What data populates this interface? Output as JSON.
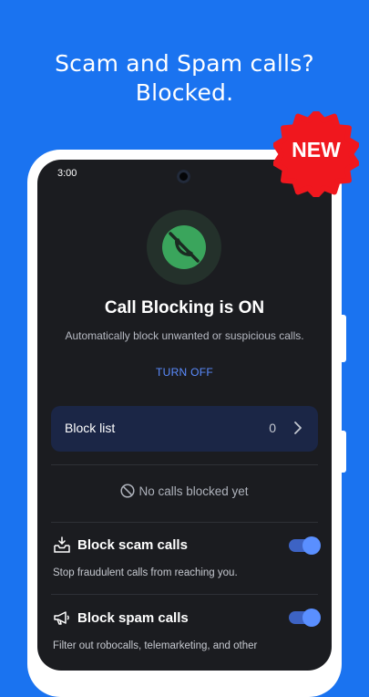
{
  "headline": {
    "line1": "Scam and Spam calls?",
    "line2": "Blocked."
  },
  "badge": {
    "label": "NEW",
    "color": "#f0171e"
  },
  "status_bar": {
    "time": "3:00"
  },
  "call_blocking": {
    "icon": "phone-blocked-icon",
    "title": "Call Blocking is ON",
    "subtitle": "Automatically block unwanted or suspicious calls.",
    "turn_off_label": "TURN OFF"
  },
  "block_list": {
    "label": "Block list",
    "count": "0"
  },
  "empty_state": {
    "text": "No calls blocked yet"
  },
  "settings": [
    {
      "title": "Block scam calls",
      "description": "Stop fraudulent calls from reaching you.",
      "icon": "scam-inbox-icon",
      "enabled": true
    },
    {
      "title": "Block spam calls",
      "description": "Filter out robocalls, telemarketing, and other",
      "icon": "megaphone-icon",
      "enabled": true
    }
  ],
  "colors": {
    "background": "#1a73f0",
    "screen": "#1b1c20",
    "accent": "#5b8cff",
    "success_green": "#3aa55c"
  }
}
